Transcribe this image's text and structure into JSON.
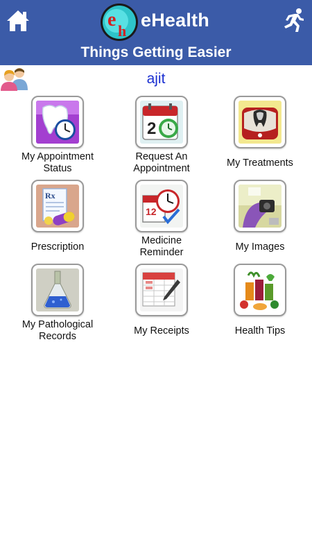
{
  "header": {
    "logo_letters": "eh",
    "app_title": "eHealth",
    "tagline": "Things Getting Easier",
    "home_icon": "home-icon",
    "exit_icon": "running-man-icon",
    "bg_color": "#3b5ba8"
  },
  "user": {
    "icon": "users-icon",
    "name": "ajit",
    "name_color": "#1a2fd1"
  },
  "menu": {
    "items": [
      {
        "label_1": "My Appointment",
        "label_2": "Status",
        "icon": "tooth-clock-icon"
      },
      {
        "label_1": "Request An",
        "label_2": "Appointment",
        "icon": "calendar-clock-icon"
      },
      {
        "label_1": "My Treatments",
        "label_2": "",
        "icon": "dental-xray-icon"
      },
      {
        "label_1": "Prescription",
        "label_2": "",
        "icon": "prescription-pill-icon"
      },
      {
        "label_1": "Medicine",
        "label_2": "Reminder",
        "icon": "calendar-alarm-icon"
      },
      {
        "label_1": "My Images",
        "label_2": "",
        "icon": "camera-photo-icon"
      },
      {
        "label_1": "My Pathological",
        "label_2": "Records",
        "icon": "lab-flask-icon"
      },
      {
        "label_1": "My Receipts",
        "label_2": "",
        "icon": "spreadsheet-pen-icon"
      },
      {
        "label_1": "Health Tips",
        "label_2": "",
        "icon": "vegetables-juice-icon"
      }
    ]
  }
}
